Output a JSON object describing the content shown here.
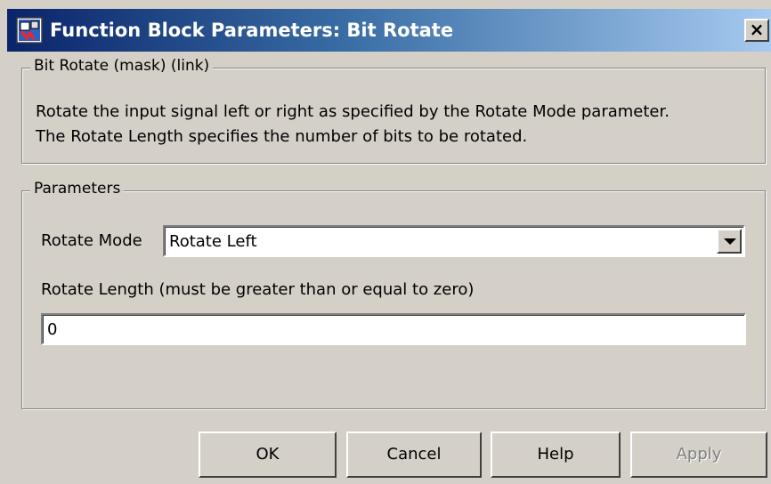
{
  "window": {
    "title": "Function Block Parameters: Bit Rotate",
    "close_label": "×",
    "icon": "simulink-block-icon"
  },
  "mask_group": {
    "legend": "Bit Rotate (mask) (link)",
    "description_line1": "Rotate the input signal left or right as specified by the Rotate Mode parameter.",
    "description_line2": "The Rotate Length specifies the number of bits to be rotated."
  },
  "params_group": {
    "legend": "Parameters",
    "rotate_mode": {
      "label": "Rotate Mode",
      "selected": "Rotate Left"
    },
    "rotate_length": {
      "label": "Rotate Length (must be greater than or equal to zero)",
      "value": "0"
    }
  },
  "buttons": {
    "ok": "OK",
    "cancel": "Cancel",
    "help": "Help",
    "apply": "Apply"
  },
  "colors": {
    "title_bar_start": "#0a246a",
    "title_bar_end": "#a6caf0",
    "dialog_background": "#d4d0c8"
  }
}
